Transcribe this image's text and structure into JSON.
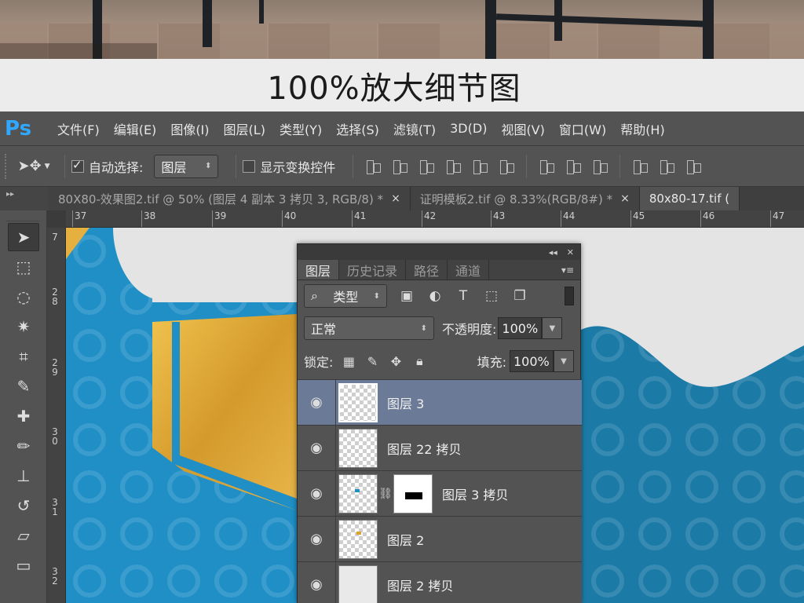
{
  "caption": "100%放大细节图",
  "app": {
    "logo": "Ps"
  },
  "menu": [
    "文件(F)",
    "编辑(E)",
    "图像(I)",
    "图层(L)",
    "类型(Y)",
    "选择(S)",
    "滤镜(T)",
    "3D(D)",
    "视图(V)",
    "窗口(W)",
    "帮助(H)"
  ],
  "options": {
    "auto_select_label": "自动选择:",
    "auto_select_checked": true,
    "auto_select_value": "图层",
    "show_transform_label": "显示变换控件",
    "show_transform_checked": false
  },
  "tabs": [
    {
      "label": "80X80-效果图2.tif @ 50% (图层 4 副本 3 拷贝 3, RGB/8) *",
      "close": "×"
    },
    {
      "label": "证明模板2.tif @ 8.33%(RGB/8#) *",
      "close": "×"
    },
    {
      "label": "80x80-17.tif (",
      "close": ""
    }
  ],
  "ruler": {
    "h": [
      "37",
      "38",
      "39",
      "40",
      "41",
      "42",
      "43",
      "44",
      "45",
      "46",
      "47"
    ],
    "v": [
      "7",
      "2 8",
      "2 9",
      "3 0",
      "3 1",
      "3 2"
    ]
  },
  "tools": [
    "move-tool",
    "marquee-tool",
    "lasso-tool",
    "magic-wand-tool",
    "crop-tool",
    "eyedropper-tool",
    "healing-brush-tool",
    "brush-tool",
    "clone-stamp-tool",
    "history-brush-tool",
    "eraser-tool",
    "gradient-tool"
  ],
  "layers_panel": {
    "collapse": "◂◂",
    "close": "✕",
    "tabs": [
      "图层",
      "历史记录",
      "路径",
      "通道"
    ],
    "active_tab": "图层",
    "filter_value": "类型",
    "blend_mode": "正常",
    "opacity_label": "不透明度:",
    "opacity": "100%",
    "lock_label": "锁定:",
    "fill_label": "填充:",
    "fill": "100%",
    "layers": [
      {
        "name": "图层 3",
        "selected": true,
        "thumb": "checker",
        "mask": false
      },
      {
        "name": "图层 22 拷贝",
        "selected": false,
        "thumb": "checker",
        "mask": false
      },
      {
        "name": "图层 3 拷贝",
        "selected": false,
        "thumb": "checker",
        "mask": true
      },
      {
        "name": "图层 2",
        "selected": false,
        "thumb": "checker",
        "mask": false
      },
      {
        "name": "图层 2 拷贝",
        "selected": false,
        "thumb": "grey",
        "mask": false
      }
    ]
  },
  "colors": {
    "ui_dark": "#535353",
    "blue_fabric": "#1f8fc6",
    "teal_fabric": "#1b7aa6",
    "gold": "#d9a434",
    "selection": "#6b7b97"
  }
}
